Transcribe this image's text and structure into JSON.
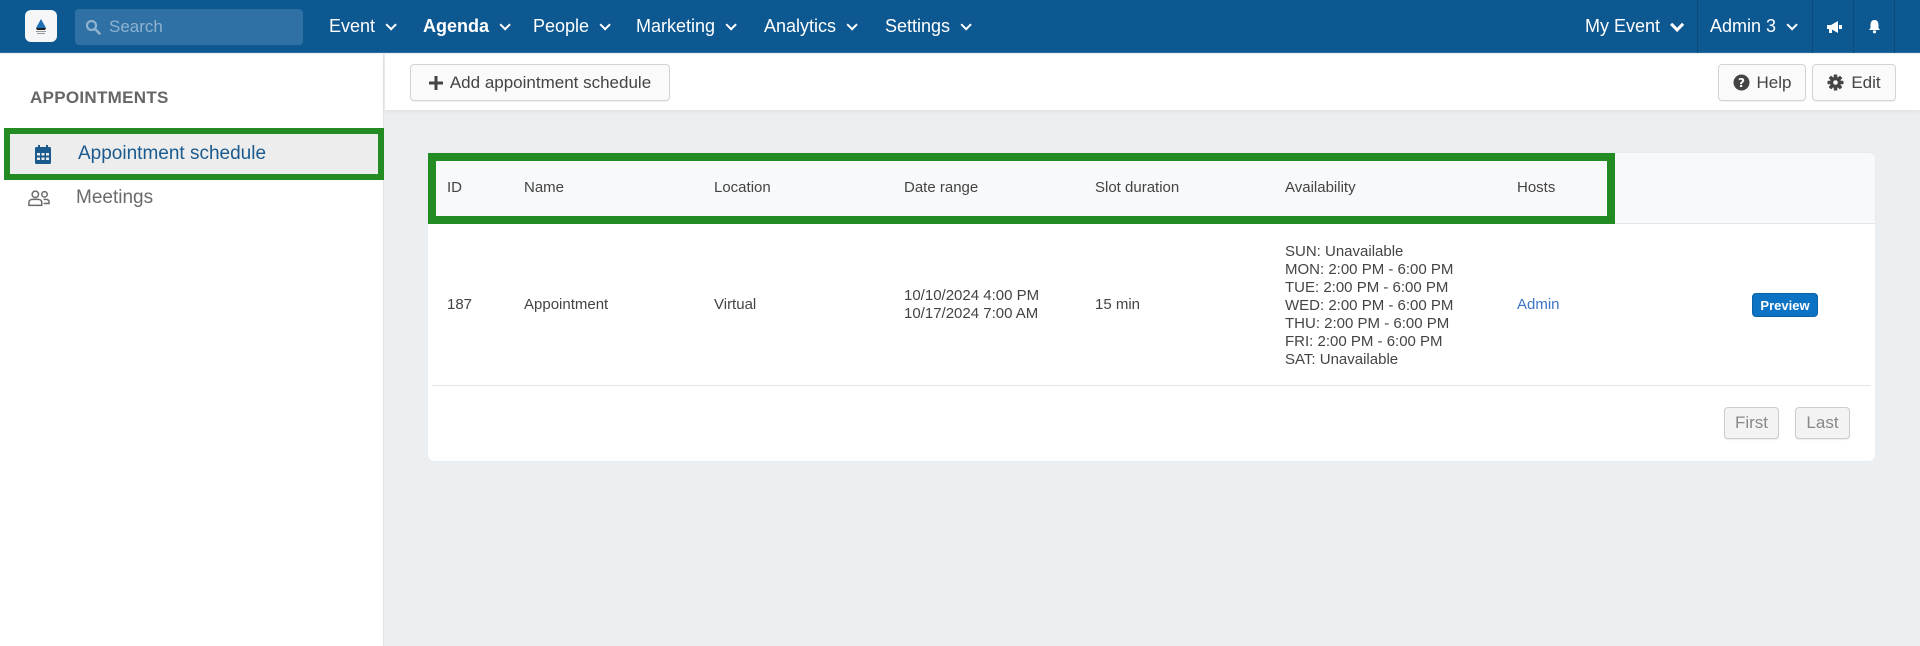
{
  "topbar": {
    "search_placeholder": "Search",
    "nav": [
      {
        "label": "Event"
      },
      {
        "label": "Agenda"
      },
      {
        "label": "People"
      },
      {
        "label": "Marketing"
      },
      {
        "label": "Analytics"
      },
      {
        "label": "Settings"
      }
    ],
    "event_selector": "My Event",
    "user_menu": "Admin 3"
  },
  "sidebar": {
    "title": "APPOINTMENTS",
    "items": [
      {
        "label": "Appointment schedule",
        "icon": "calendar-icon",
        "active": true
      },
      {
        "label": "Meetings",
        "icon": "users-icon",
        "active": false
      }
    ]
  },
  "toolbar": {
    "add_label": "Add appointment schedule",
    "help_label": "Help",
    "edit_label": "Edit"
  },
  "table": {
    "columns": [
      "ID",
      "Name",
      "Location",
      "Date range",
      "Slot duration",
      "Availability",
      "Hosts"
    ],
    "rows": [
      {
        "id": "187",
        "name": "Appointment",
        "location": "Virtual",
        "date_start": "10/10/2024 4:00 PM",
        "date_end": "10/17/2024 7:00 AM",
        "slot_duration": "15 min",
        "availability": [
          "SUN: Unavailable",
          "MON: 2:00 PM - 6:00 PM",
          "TUE: 2:00 PM - 6:00 PM",
          "WED: 2:00 PM - 6:00 PM",
          "THU: 2:00 PM - 6:00 PM",
          "FRI: 2:00 PM - 6:00 PM",
          "SAT: Unavailable"
        ],
        "host": "Admin",
        "action_label": "Preview"
      }
    ]
  },
  "pagination": {
    "first_label": "First",
    "last_label": "Last"
  },
  "colors": {
    "topbar": "#0e5891",
    "highlight": "#228b22",
    "primary": "#0c73c4",
    "link": "#3b74c4"
  }
}
